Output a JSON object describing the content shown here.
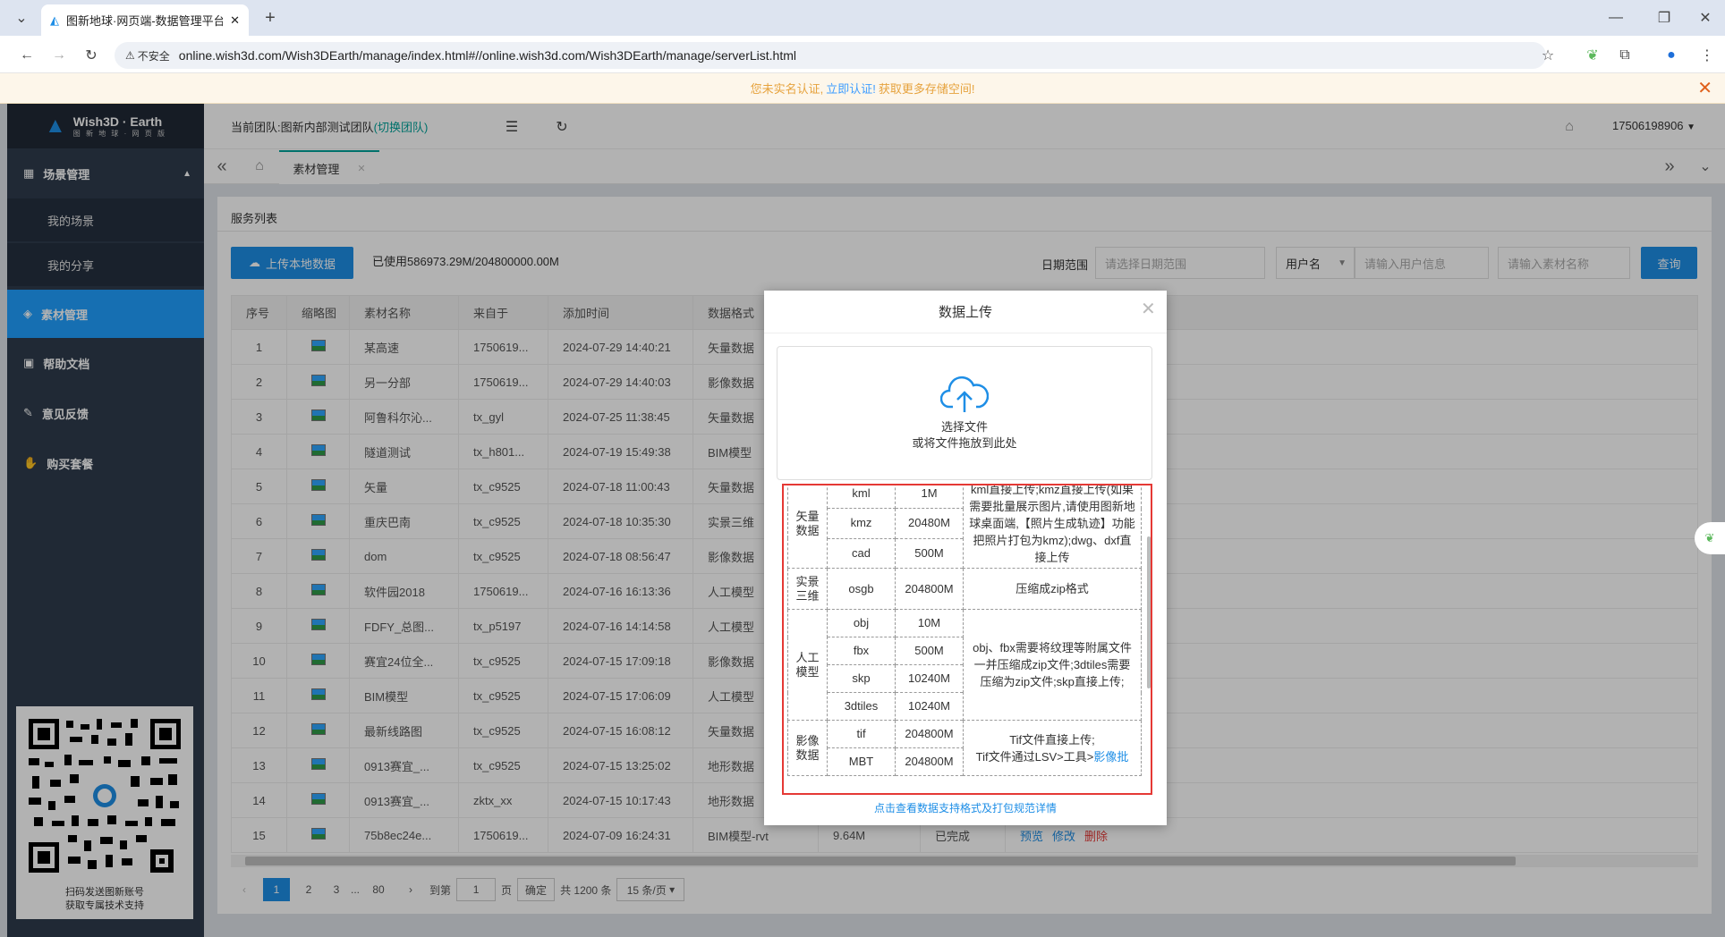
{
  "browser": {
    "tab_title": "图新地球·网页端-数据管理平台",
    "not_secure": "不安全",
    "url": "online.wish3d.com/Wish3DEarth/manage/index.html#//online.wish3d.com/Wish3DEarth/manage/serverList.html"
  },
  "notice": {
    "prefix": "您未实名认证,",
    "link": "立即认证!",
    "suffix": "获取更多存储空间!"
  },
  "logo": {
    "title": "Wish3D · Earth",
    "sub": "图 新 地 球 · 网 页 版"
  },
  "sidebar": {
    "items": [
      {
        "label": "场景管理"
      },
      {
        "label": "我的场景"
      },
      {
        "label": "我的分享"
      },
      {
        "label": "素材管理"
      },
      {
        "label": "帮助文档"
      },
      {
        "label": "意见反馈"
      },
      {
        "label": "购买套餐"
      }
    ],
    "qr_caption1": "扫码发送图新账号",
    "qr_caption2": "获取专属技术支持"
  },
  "header": {
    "team_label": "当前团队:",
    "team_name": "图新内部测试团队",
    "switch": "(切换团队)",
    "user": "17506198906"
  },
  "tabs": {
    "material": "素材管理"
  },
  "content": {
    "title": "服务列表",
    "upload": "上传本地数据",
    "usage": "已使用586973.29M/204800000.00M",
    "date_label": "日期范围",
    "date_placeholder": "请选择日期范围",
    "user_select": "用户名",
    "user_placeholder": "请输入用户信息",
    "material_placeholder": "请输入素材名称",
    "query": "查询"
  },
  "table": {
    "headers": [
      "序号",
      "缩略图",
      "素材名称",
      "来自于",
      "添加时间",
      "数据格式"
    ],
    "rows": [
      [
        "1",
        "某高速",
        "1750619...",
        "2024-07-29 14:40:21",
        "矢量数据"
      ],
      [
        "2",
        "另一分部",
        "1750619...",
        "2024-07-29 14:40:03",
        "影像数据"
      ],
      [
        "3",
        "阿鲁科尔沁...",
        "tx_gyl",
        "2024-07-25 11:38:45",
        "矢量数据"
      ],
      [
        "4",
        "隧道测试",
        "tx_h801...",
        "2024-07-19 15:49:38",
        "BIM模型"
      ],
      [
        "5",
        "矢量",
        "tx_c9525",
        "2024-07-18 11:00:43",
        "矢量数据"
      ],
      [
        "6",
        "重庆巴南",
        "tx_c9525",
        "2024-07-18 10:35:30",
        "实景三维"
      ],
      [
        "7",
        "dom",
        "tx_c9525",
        "2024-07-18 08:56:47",
        "影像数据"
      ],
      [
        "8",
        "软件园2018",
        "1750619...",
        "2024-07-16 16:13:36",
        "人工模型"
      ],
      [
        "9",
        "FDFY_总图...",
        "tx_p5197",
        "2024-07-16 14:14:58",
        "人工模型"
      ],
      [
        "10",
        "赛宜24位全...",
        "tx_c9525",
        "2024-07-15 17:09:18",
        "影像数据"
      ],
      [
        "11",
        "BIM模型",
        "tx_c9525",
        "2024-07-15 17:06:09",
        "人工模型"
      ],
      [
        "12",
        "最新线路图",
        "tx_c9525",
        "2024-07-15 16:08:12",
        "矢量数据"
      ],
      [
        "13",
        "0913赛宜_...",
        "tx_c9525",
        "2024-07-15 13:25:02",
        "地形数据"
      ],
      [
        "14",
        "0913赛宜_...",
        "zktx_xx",
        "2024-07-15 10:17:43",
        "地形数据"
      ],
      [
        "15",
        "75b8ec24e...",
        "1750619...",
        "2024-07-09 16:24:31",
        "BIM模型-rvt"
      ]
    ],
    "last_row_extra": {
      "size": "9.64M",
      "status": "已完成",
      "preview": "预览",
      "edit": "修改",
      "delete": "删除"
    }
  },
  "pager": {
    "pages": [
      "1",
      "2",
      "3",
      "...",
      "80"
    ],
    "goto": "到第",
    "page_input": "1",
    "page_unit": "页",
    "confirm": "确定",
    "total": "共 1200 条",
    "page_size": "15 条/页"
  },
  "modal": {
    "title": "数据上传",
    "select_file": "选择文件",
    "drag_hint": "或将文件拖放到此处",
    "detail_link": "点击查看数据支持格式及打包规范详情",
    "groups": {
      "vector": {
        "name": "矢量数据",
        "rows": [
          [
            "kml",
            "1M"
          ],
          [
            "kmz",
            "20480M"
          ],
          [
            "cad",
            "500M"
          ]
        ],
        "note": "kml直接上传;kmz直接上传(如果需要批量展示图片,请使用图新地球桌面端,【照片生成轨迹】功能把照片打包为kmz);dwg、dxf直接上传"
      },
      "reality": {
        "name": "实景三维",
        "rows": [
          [
            "osgb",
            "204800M"
          ]
        ],
        "note": "压缩成zip格式"
      },
      "model": {
        "name": "人工模型",
        "rows": [
          [
            "obj",
            "10M"
          ],
          [
            "fbx",
            "500M"
          ],
          [
            "skp",
            "10240M"
          ],
          [
            "3dtiles",
            "10240M"
          ]
        ],
        "note": "obj、fbx需要将纹理等附属文件一并压缩成zip文件;3dtiles需要压缩为zip文件;skp直接上传;"
      },
      "image": {
        "name": "影像数据",
        "rows": [
          [
            "tif",
            "204800M"
          ],
          [
            "MBT",
            "204800M"
          ]
        ],
        "note1": "Tif文件直接上传;",
        "note2": "Tif文件通过LSV>工具>",
        "note_link": "影像批"
      }
    }
  }
}
